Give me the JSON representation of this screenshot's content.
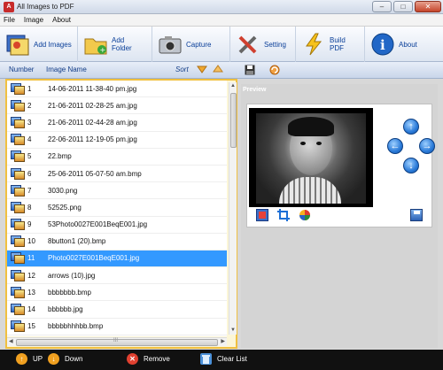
{
  "window": {
    "title": "All Images to PDF",
    "controls": {
      "minimize": "–",
      "maximize": "□",
      "close": "✕"
    }
  },
  "menu": [
    "File",
    "Image",
    "About"
  ],
  "toolbar": [
    {
      "label": "Add Images",
      "icon": "add-images-icon"
    },
    {
      "label": "Add Folder",
      "icon": "folder-icon"
    },
    {
      "label": "Capture",
      "icon": "camera-icon"
    },
    {
      "label": "Setting",
      "icon": "tools-icon"
    },
    {
      "label": "Build PDF",
      "icon": "lightning-icon"
    },
    {
      "label": "About",
      "icon": "info-icon"
    }
  ],
  "list_header": {
    "number": "Number",
    "image_name": "Image Name",
    "sort": "Sort"
  },
  "list": [
    {
      "num": "1",
      "name": "14-06-2011 11-38-40 pm.jpg"
    },
    {
      "num": "2",
      "name": "21-06-2011 02-28-25 am.jpg"
    },
    {
      "num": "3",
      "name": "21-06-2011 02-44-28 am.jpg"
    },
    {
      "num": "4",
      "name": "22-06-2011 12-19-05 pm.jpg"
    },
    {
      "num": "5",
      "name": "22.bmp"
    },
    {
      "num": "6",
      "name": "25-06-2011 05-07-50 am.bmp"
    },
    {
      "num": "7",
      "name": "3030.png"
    },
    {
      "num": "8",
      "name": "52525.png"
    },
    {
      "num": "9",
      "name": "53Photo0027E001BeqE001.jpg"
    },
    {
      "num": "10",
      "name": "8button1 (20).bmp"
    },
    {
      "num": "11",
      "name": "Photo0027E001BeqE001.jpg"
    },
    {
      "num": "12",
      "name": "arrows (10).jpg"
    },
    {
      "num": "13",
      "name": "bbbbbbb.bmp"
    },
    {
      "num": "14",
      "name": "bbbbbb.jpg"
    },
    {
      "num": "15",
      "name": "bbbbbhhhbb.bmp"
    }
  ],
  "selected_index": 10,
  "preview": {
    "label": "Preview",
    "tools": [
      "image-icon",
      "crop-icon",
      "color-wheel-icon"
    ],
    "nav": {
      "up": "↑",
      "left": "←",
      "right": "→",
      "down": "↓"
    }
  },
  "bottom": [
    {
      "label": "UP",
      "icon": "up-arrow-icon",
      "color": "#f0a020",
      "glyph": "↑"
    },
    {
      "label": "Down",
      "icon": "down-arrow-icon",
      "color": "#f0a020",
      "glyph": "↓"
    },
    {
      "label": "Remove",
      "icon": "remove-icon",
      "color": "#e04030",
      "glyph": "✕"
    },
    {
      "label": "Clear List",
      "icon": "trash-icon",
      "color": "#4a90d9",
      "glyph": ""
    }
  ]
}
